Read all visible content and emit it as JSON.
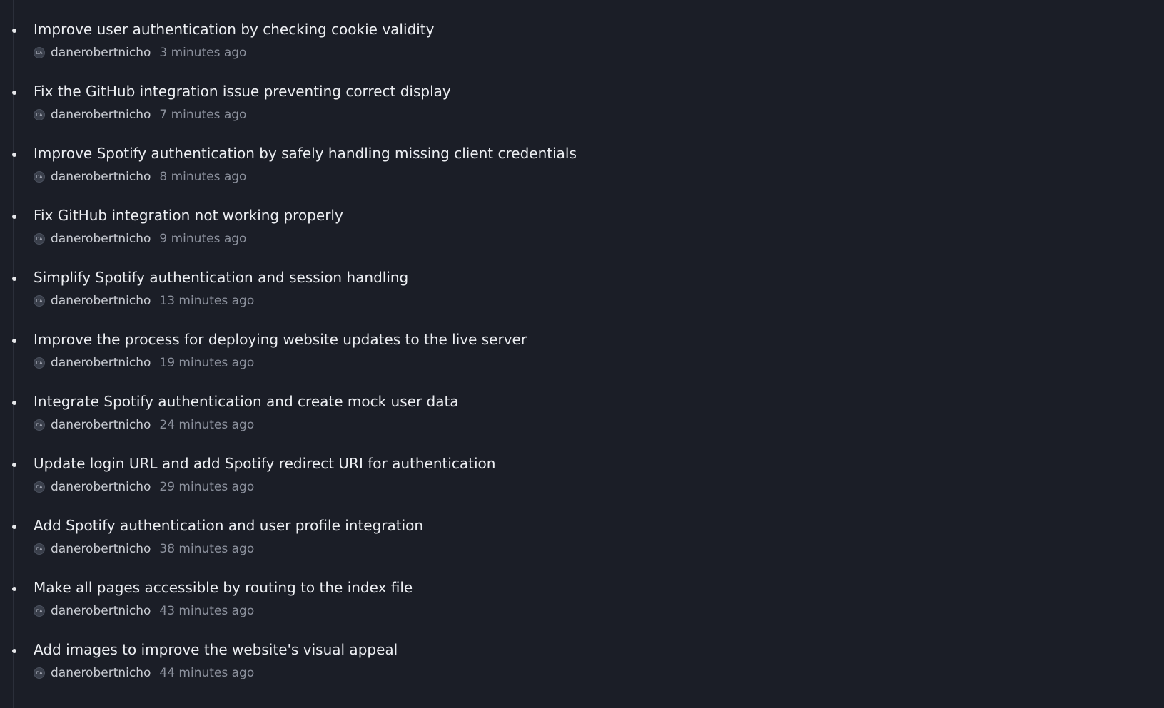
{
  "commits": [
    {
      "title": "Improve user authentication by checking cookie validity",
      "author": "danerobertnicho",
      "avatar_initials": "DA",
      "time": "3 minutes ago"
    },
    {
      "title": "Fix the GitHub integration issue preventing correct display",
      "author": "danerobertnicho",
      "avatar_initials": "DA",
      "time": "7 minutes ago"
    },
    {
      "title": "Improve Spotify authentication by safely handling missing client credentials",
      "author": "danerobertnicho",
      "avatar_initials": "DA",
      "time": "8 minutes ago"
    },
    {
      "title": "Fix GitHub integration not working properly",
      "author": "danerobertnicho",
      "avatar_initials": "DA",
      "time": "9 minutes ago"
    },
    {
      "title": "Simplify Spotify authentication and session handling",
      "author": "danerobertnicho",
      "avatar_initials": "DA",
      "time": "13 minutes ago"
    },
    {
      "title": "Improve the process for deploying website updates to the live server",
      "author": "danerobertnicho",
      "avatar_initials": "DA",
      "time": "19 minutes ago"
    },
    {
      "title": "Integrate Spotify authentication and create mock user data",
      "author": "danerobertnicho",
      "avatar_initials": "DA",
      "time": "24 minutes ago"
    },
    {
      "title": "Update login URL and add Spotify redirect URI for authentication",
      "author": "danerobertnicho",
      "avatar_initials": "DA",
      "time": "29 minutes ago"
    },
    {
      "title": "Add Spotify authentication and user profile integration",
      "author": "danerobertnicho",
      "avatar_initials": "DA",
      "time": "38 minutes ago"
    },
    {
      "title": "Make all pages accessible by routing to the index file",
      "author": "danerobertnicho",
      "avatar_initials": "DA",
      "time": "43 minutes ago"
    },
    {
      "title": "Add images to improve the website's visual appeal",
      "author": "danerobertnicho",
      "avatar_initials": "DA",
      "time": "44 minutes ago"
    }
  ]
}
